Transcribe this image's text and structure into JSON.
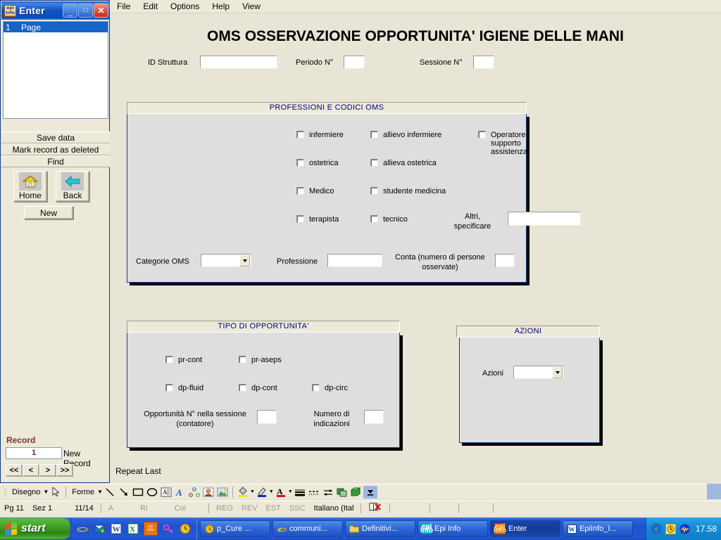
{
  "enter_window": {
    "title": "Enter",
    "app_icon": "epiinfo-icon",
    "buttons": {
      "minimize": "_",
      "maximize": "□",
      "close": "✕"
    },
    "page_list": [
      {
        "num": "1",
        "label": "Page"
      }
    ],
    "actions": [
      {
        "name": "save-data",
        "label": "Save data",
        "accel": "S"
      },
      {
        "name": "mark-record-as-deleted",
        "label": "Mark record as deleted",
        "accel": "d"
      },
      {
        "name": "find",
        "label": "Find",
        "accel": "F"
      }
    ],
    "nav_buttons": [
      {
        "name": "home",
        "label": "Home",
        "icon": "house-icon"
      },
      {
        "name": "back",
        "label": "Back",
        "icon": "left-arrow-icon"
      }
    ],
    "new_button": {
      "label": "New"
    },
    "record": {
      "section_label": "Record",
      "value": "1",
      "status": "New Record",
      "pager": [
        "<<",
        "<",
        ">",
        ">>"
      ]
    }
  },
  "menubar": {
    "items": [
      "File",
      "Edit",
      "Options",
      "Help",
      "View"
    ]
  },
  "form": {
    "title": "OMS OSSERVAZIONE OPPORTUNITA' IGIENE DELLE MANI",
    "header_fields": [
      {
        "label": "ID Struttura",
        "value": "",
        "placeholder": ""
      },
      {
        "label": "Periodo N°",
        "value": "",
        "placeholder": ""
      },
      {
        "label": "Sessione N°",
        "value": "",
        "placeholder": ""
      }
    ],
    "professioni": {
      "title": "PROFESSIONI E CODICI OMS",
      "checkboxes": [
        {
          "label": "infermiere",
          "checked": false
        },
        {
          "label": "allievo infermiere",
          "checked": false
        },
        {
          "label": "Operatore supporto assistenza",
          "checked": false
        },
        {
          "label": "ostetrica",
          "checked": false
        },
        {
          "label": "allieva ostetrica",
          "checked": false
        },
        {
          "label": "Medico",
          "checked": false
        },
        {
          "label": "studente medicina",
          "checked": false
        },
        {
          "label": "terapista",
          "checked": false
        },
        {
          "label": "tecnico",
          "checked": false
        }
      ],
      "altri_label_line1": "Altri,",
      "altri_label_line2": "specificare",
      "altri_value": "",
      "categorie_label": "Categorie OMS",
      "categorie_value": "",
      "professione_label": "Professione",
      "professione_value": "",
      "conta_label_line1": "Conta (numero di persone",
      "conta_label_line2": "osservate)",
      "conta_value": ""
    },
    "opportunita": {
      "title": "TIPO DI OPPORTUNITA'",
      "checkboxes": [
        {
          "label": "pr-cont",
          "checked": false
        },
        {
          "label": "pr-aseps",
          "checked": false
        },
        {
          "label": "dp-fluid",
          "checked": false
        },
        {
          "label": "dp-cont",
          "checked": false
        },
        {
          "label": "dp-circ",
          "checked": false
        }
      ],
      "contatore_label_line1": "Opportunità N° nella sessione",
      "contatore_label_line2": "(contatore)",
      "contatore_value": "",
      "indicazioni_label_line1": "Numero di",
      "indicazioni_label_line2": "indicazioni",
      "indicazioni_value": ""
    },
    "azioni": {
      "title": "AZIONI",
      "field_label": "Azioni",
      "field_value": ""
    },
    "repeat_last": "Repeat Last"
  },
  "draw_toolbar": {
    "disegno_label": "Disegno",
    "forme_label": "Forme",
    "icons": [
      "pointer-icon",
      "line-icon",
      "arrow-icon",
      "rectangle-icon",
      "ellipse-icon",
      "textbox-icon",
      "wordart-icon",
      "diagram-icon",
      "clipart-icon",
      "picture-icon",
      "fill-color-icon",
      "line-color-icon",
      "font-color-icon",
      "line-style-icon",
      "dash-style-icon",
      "arrow-style-icon",
      "shadow-icon",
      "3d-icon",
      "toolbar-overflow-icon"
    ]
  },
  "status_bar": {
    "page": "Pg  11",
    "section": "Sez  1",
    "pages": "11/14",
    "at": "A",
    "ri": "Ri",
    "col": "Col",
    "reg": "REG",
    "rev": "REV",
    "est": "EST",
    "ssc": "SSC",
    "language": "Italiano (Ital",
    "spellcheck_icon": "spellcheck-error-icon"
  },
  "taskbar": {
    "start_label": "start",
    "quicklaunch": [
      "internet-explorer-icon",
      "outlook-express-icon",
      "word-icon",
      "excel-icon",
      "epiinfo-icon",
      "key-icon",
      "clock-icon"
    ],
    "tasks": [
      {
        "label": "p_Cure ...",
        "icon": "clock-icon",
        "active": false
      },
      {
        "label": "communi...",
        "icon": "internet-explorer-icon",
        "active": false
      },
      {
        "label": "Definitivi...",
        "icon": "folder-icon",
        "active": false
      },
      {
        "label": "Epi Info",
        "icon": "epiinfo-icon",
        "active": false
      },
      {
        "label": "Enter",
        "icon": "epiinfo-icon",
        "active": true
      },
      {
        "label": "EpiInfo_I...",
        "icon": "word-icon",
        "active": false
      }
    ],
    "tray": {
      "chevron": "‹",
      "icons": [
        "clock-icon",
        "volume-icon"
      ],
      "clock": "17.58"
    }
  }
}
